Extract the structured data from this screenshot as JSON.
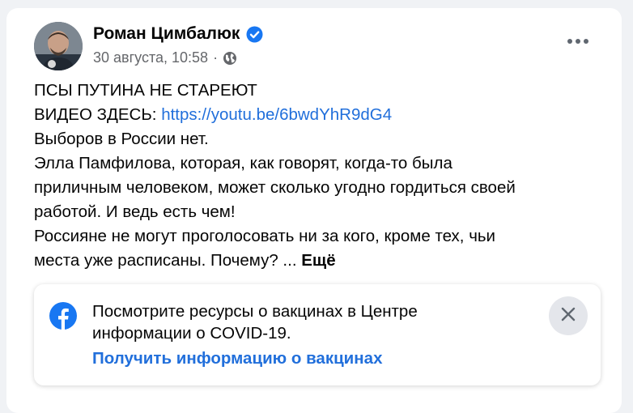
{
  "post": {
    "author": "Роман Цимбалюк",
    "date": "30 августа, 10:58",
    "separator": "·",
    "lines": [
      "ПСЫ ПУТИНА НЕ СТАРЕЮТ",
      "Выборов в России нет.",
      "Элла Памфилова, которая, как говорят, когда-то была",
      "приличным человеком, может сколько угодно гордиться своей",
      "работой. И ведь есть чем!",
      "Россияне не могут проголосовать ни за кого, кроме тех, чьи",
      "места уже расписаны. Почему? ..."
    ],
    "video_prefix": "ВИДЕО ЗДЕСЬ: ",
    "video_link": "https://youtu.be/6bwdYhR9dG4",
    "see_more": "Ещё"
  },
  "covid_banner": {
    "line1": "Посмотрите ресурсы о вакцинах в Центре",
    "line2": "информации о COVID-19.",
    "link": "Получить информацию о вакцинах"
  },
  "icons": {
    "verified": "verified-badge-icon",
    "privacy": "globe-icon",
    "menu": "more-options-icon",
    "brand": "facebook-logo-icon",
    "close": "close-icon"
  },
  "colors": {
    "link": "#216fdb",
    "verified": "#1877f2",
    "muted": "#65676b",
    "facebook": "#1877f2"
  }
}
